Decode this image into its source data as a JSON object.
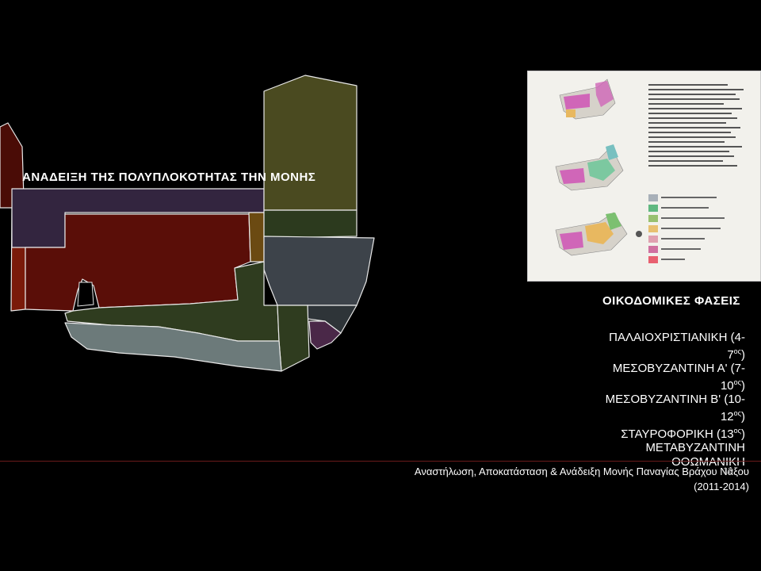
{
  "slide": {
    "title": "ΑΝΑΔΕΙΞΗ ΤΗΣ ΠΟΛΥΠΛΟΚΟΤΗΤΑΣ  ΤΗΝ ΜΟΝΗΣ",
    "phases_heading": "ΟΙΚΟΔΟΜΙΚΕΣ  ΦΑΣΕΙΣ",
    "phases": [
      {
        "text": "ΠΑΛΑΙΟΧΡΙΣΤΙΑΝΙΚΗ (4-7",
        "sup": "ος",
        "tail": ")"
      },
      {
        "text": "ΜΕΣΟΒΥΖΑΝΤΙΝΗ Α' (7-10",
        "sup": "ος",
        "tail": ")"
      },
      {
        "text": "ΜΕΣΟΒΥΖΑΝΤΙΝΗ Β' (10-12",
        "sup": "ος",
        "tail": ")"
      },
      {
        "text": "ΣΤΑΥΡΟΦΟΡΙΚΗ (13",
        "sup": "ος",
        "tail": ")"
      },
      {
        "text": "ΜΕΤΑΒΥΖΑΝΤΙΝΗ",
        "sup": "",
        "tail": ""
      },
      {
        "text": "ΟΘΩΜΑΝΙΚΗ",
        "sup": "",
        "tail": ""
      }
    ],
    "footer_line1": "Αναστήλωση, Αποκατάσταση & Ανάδειξη Μονής Παναγίας Βράχου Νάξου",
    "footer_line2": "(2011-2014)",
    "page_number": "12"
  },
  "colors": {
    "maroon": "#5a0e08",
    "dark_red": "#8a1a0c",
    "purple": "#3a2a4c",
    "olive": "#4a4a20",
    "dark_green": "#2c3a1e",
    "slate": "#3c4248",
    "light_slate": "#6a7878",
    "ochre": "#6a4a10",
    "violet": "#4a2a48"
  }
}
